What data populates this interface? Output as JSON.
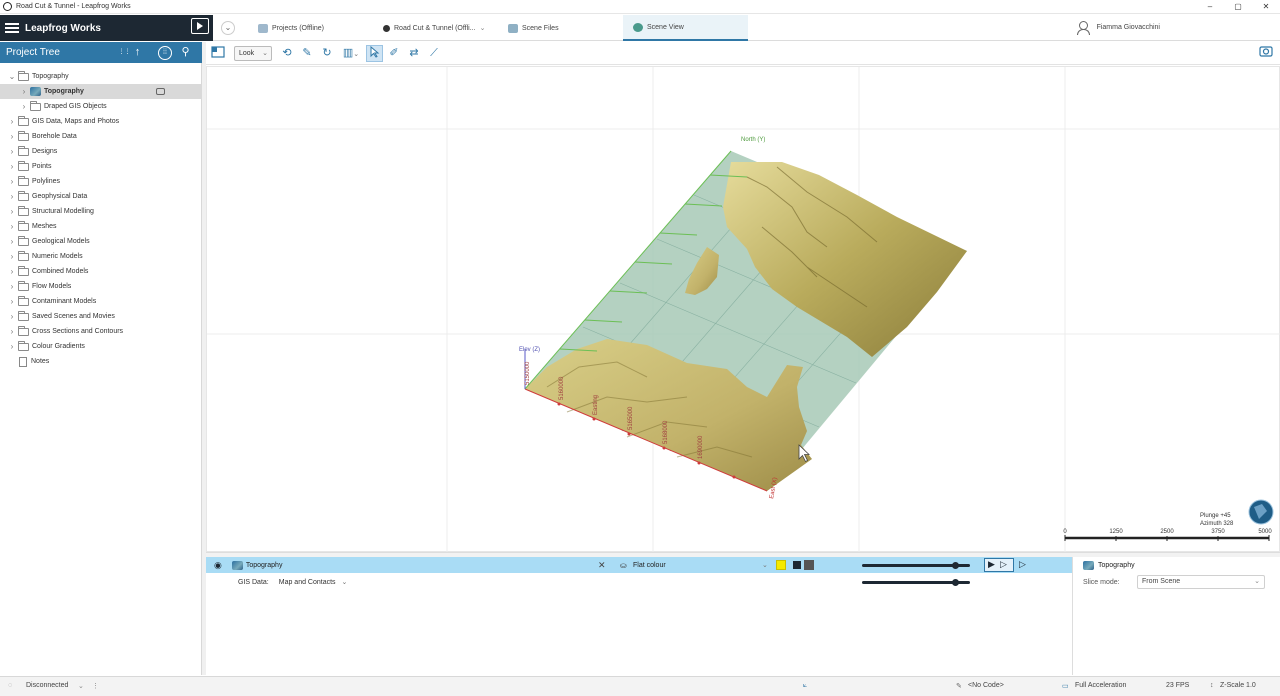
{
  "window": {
    "title": "Road Cut & Tunnel - Leapfrog Works",
    "controls": [
      "–",
      "▢",
      "✕"
    ]
  },
  "brand": {
    "name": "Leapfrog Works"
  },
  "tabs": [
    {
      "label": "Projects (Offline)",
      "icon": "projects-icon"
    },
    {
      "label": "Road Cut & Tunnel (Offli...",
      "icon": "project-icon"
    },
    {
      "label": "Scene Files",
      "icon": "scene-files-icon"
    },
    {
      "label": "Scene View",
      "icon": "scene-view-icon",
      "active": true
    }
  ],
  "user": {
    "name": "Fiamma Giovacchini"
  },
  "project_tree": {
    "title": "Project Tree",
    "items": [
      {
        "label": "Topography",
        "expanded": true,
        "level": 0
      },
      {
        "label": "Topography",
        "level": 1,
        "selected": true,
        "icon": "topography-icon"
      },
      {
        "label": "Draped GIS Objects",
        "level": 1
      },
      {
        "label": "GIS Data, Maps and Photos",
        "level": 0
      },
      {
        "label": "Borehole Data",
        "level": 0
      },
      {
        "label": "Designs",
        "level": 0
      },
      {
        "label": "Points",
        "level": 0
      },
      {
        "label": "Polylines",
        "level": 0
      },
      {
        "label": "Geophysical Data",
        "level": 0
      },
      {
        "label": "Structural Modelling",
        "level": 0
      },
      {
        "label": "Meshes",
        "level": 0
      },
      {
        "label": "Geological Models",
        "level": 0
      },
      {
        "label": "Numeric Models",
        "level": 0
      },
      {
        "label": "Combined Models",
        "level": 0
      },
      {
        "label": "Flow Models",
        "level": 0
      },
      {
        "label": "Contaminant Models",
        "level": 0
      },
      {
        "label": "Saved Scenes and Movies",
        "level": 0
      },
      {
        "label": "Cross Sections and Contours",
        "level": 0
      },
      {
        "label": "Colour Gradients",
        "level": 0
      },
      {
        "label": "Notes",
        "level": 0,
        "icon": "notes-icon"
      }
    ]
  },
  "scene_toolbar": {
    "look_label": "Look"
  },
  "scene": {
    "axis_labels": {
      "north": "North (Y)",
      "elev": "Elev (Z)",
      "east": "East (X)"
    },
    "tick_labels_east": [
      "5150000",
      "5160000",
      "Easting",
      "5165000",
      "5168000",
      "1690000"
    ],
    "orientation": {
      "plunge": "Plunge +45",
      "azimuth": "Azimuth 328"
    },
    "scale_bar": [
      "0",
      "1250",
      "2500",
      "3750",
      "5000"
    ]
  },
  "shape_list": {
    "row1": {
      "name": "Topography",
      "colour_mode": "Flat colour",
      "swatch": "#f5ea00"
    },
    "row2": {
      "label": "GIS Data:",
      "value": "Map and Contacts"
    }
  },
  "properties": {
    "title": "Topography",
    "slice_mode_label": "Slice mode:",
    "slice_mode_value": "From Scene"
  },
  "status_bar": {
    "connection": "Disconnected",
    "code": "<No Code>",
    "acceleration": "Full Acceleration",
    "fps": "23 FPS",
    "zscale": "Z-Scale 1.0"
  }
}
